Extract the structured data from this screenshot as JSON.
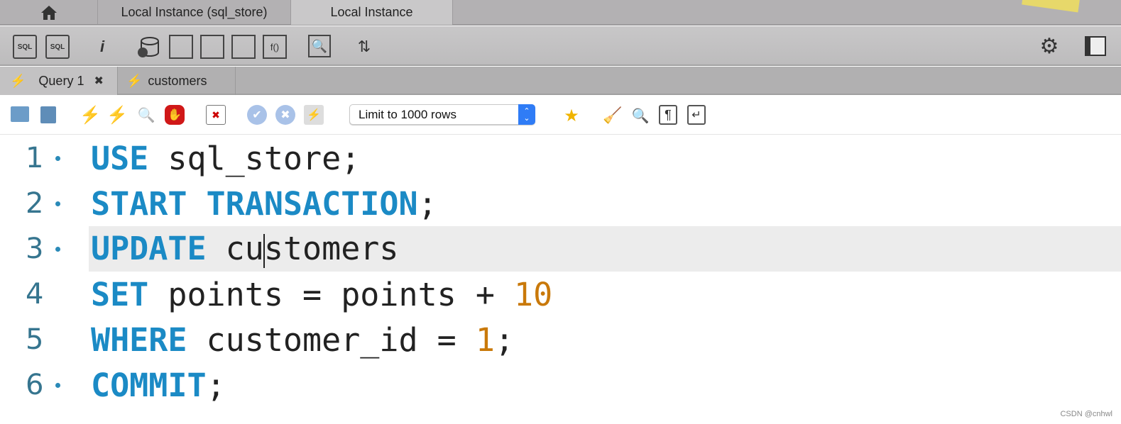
{
  "window_tabs": [
    {
      "label": "Local Instance  (sql_store)"
    },
    {
      "label": "Local Instance"
    }
  ],
  "toolbar_icons": [
    "new-sql-tab",
    "open-sql-file",
    "inspector",
    "create-schema",
    "create-table",
    "create-view",
    "create-procedure",
    "create-function",
    "search-table-data",
    "reconnect",
    "preferences-gear",
    "toggle-sidebar"
  ],
  "query_tabs": [
    {
      "label": "Query 1",
      "active": true
    },
    {
      "label": "customers",
      "active": false
    }
  ],
  "editor_toolbar": {
    "limit_select": "Limit to 1000 rows"
  },
  "editor": {
    "lines": [
      {
        "number": "1",
        "dot": true
      },
      {
        "number": "2",
        "dot": true
      },
      {
        "number": "3",
        "dot": true
      },
      {
        "number": "4",
        "dot": false
      },
      {
        "number": "5",
        "dot": false
      },
      {
        "number": "6",
        "dot": true
      }
    ],
    "tokens": {
      "l1_kw": "USE",
      "l1_rest": " sql_store;",
      "l2_kw": "START TRANSACTION",
      ";": ";",
      "l3_kw": "UPDATE",
      "l3_a": " cu",
      "l3_b": "stomers",
      "l4_kw": "SET",
      "l4_rest": " points = points + ",
      "l4_num": "10",
      "l5_kw": "WHERE",
      "l5_rest": " customer_id = ",
      "l5_num": "1",
      "l5_end": ";",
      "l6_kw": "COMMIT",
      "l6_end": ";"
    }
  },
  "watermark": "CSDN @cnhwl",
  "colors": {
    "keyword": "#1b8ac5",
    "number": "#c9790a",
    "highlight": "#ececec"
  }
}
